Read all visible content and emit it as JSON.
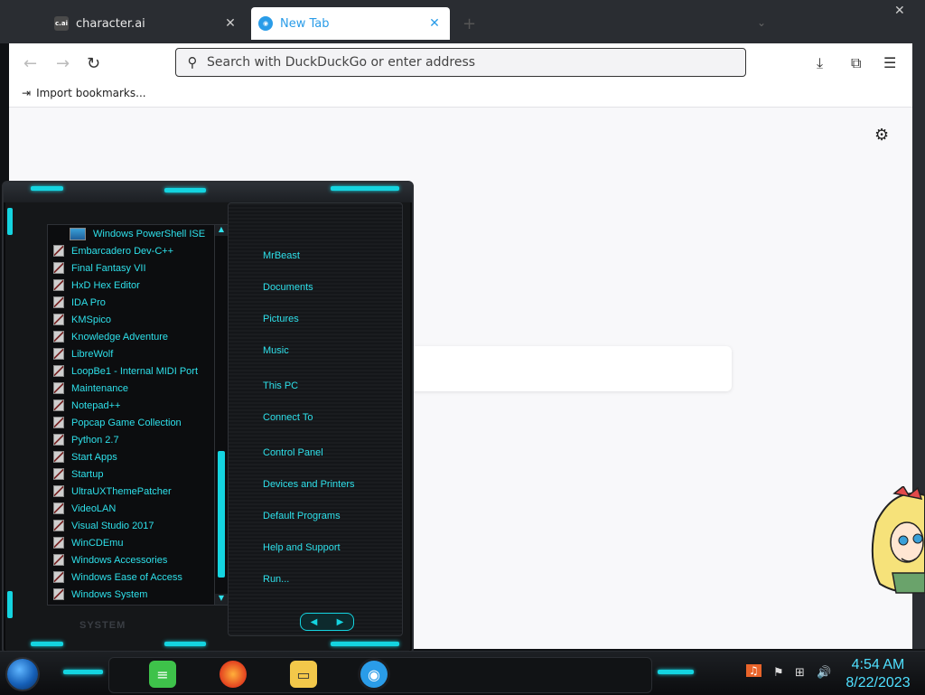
{
  "browser": {
    "tabs": [
      {
        "title": "character.ai",
        "favicon": "c.ai",
        "active": false
      },
      {
        "title": "New Tab",
        "favicon": "duck-icon",
        "active": true
      }
    ],
    "url_placeholder": "Search with DuckDuckGo or enter address",
    "bookmark_label": "Import bookmarks..."
  },
  "start_menu": {
    "programs": [
      "Windows PowerShell ISE",
      "Embarcadero Dev-C++",
      "Final Fantasy VII",
      "HxD Hex Editor",
      "IDA Pro",
      "KMSpico",
      "Knowledge Adventure",
      "LibreWolf",
      "LoopBe1 - Internal MIDI Port",
      "Maintenance",
      "Notepad++",
      "Popcap Game Collection",
      "Python 2.7",
      "Start Apps",
      "Startup",
      "UltraUXThemePatcher",
      "VideoLAN",
      "Visual Studio 2017",
      "WinCDEmu",
      "Windows Accessories",
      "Windows Ease of Access",
      "Windows System"
    ],
    "places": [
      "MrBeast",
      "Documents",
      "Pictures",
      "Music",
      "This PC",
      "Connect To",
      "Control Panel",
      "Devices and Printers",
      "Default Programs",
      "Help and Support",
      "Run..."
    ],
    "footer_label": "SYSTEM"
  },
  "taskbar": {
    "time": "4:54 AM",
    "date": "8/22/2023"
  },
  "colors": {
    "accent_cyan": "#2ee0ea",
    "browser_accent": "#2a9ce8"
  }
}
